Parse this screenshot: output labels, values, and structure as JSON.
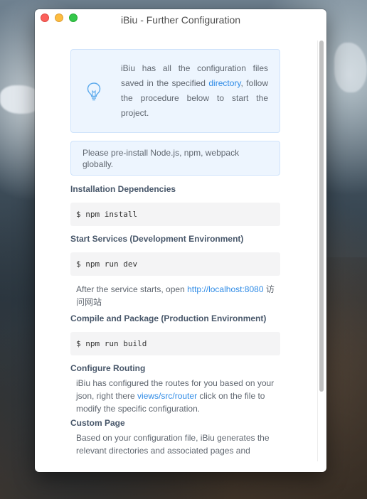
{
  "window": {
    "title": "iBiu - Further Configuration"
  },
  "info": {
    "text_before": "iBiu has all the configuration files saved in the specified ",
    "link": "directory",
    "text_after": ", follow the procedure below to start the project."
  },
  "note": {
    "text": "Please pre-install Node.js, npm, webpack globally."
  },
  "sections": {
    "install": {
      "heading": "Installation Dependencies",
      "command": "$ npm install"
    },
    "dev": {
      "heading": "Start Services (Development Environment)",
      "command": "$ npm run dev",
      "after_before": "After the service starts, open ",
      "after_link": "http://localhost:8080",
      "after_after": " 访问网站"
    },
    "build": {
      "heading": "Compile and Package (Production Environment)",
      "command": "$ npm run build"
    },
    "routing": {
      "heading": "Configure Routing",
      "text_before": "iBiu has configured the routes for you based on your json, right there ",
      "link": "views/src/router",
      "text_after": " click on the file to modify the specific configuration."
    },
    "custom": {
      "heading": "Custom Page",
      "text": "Based on your configuration file, iBiu generates the relevant directories and associated pages and"
    }
  },
  "colors": {
    "accent_link": "#2f8be6",
    "info_bg": "#edf5fe",
    "code_bg": "#f4f4f5"
  },
  "icons": {
    "info": "lightbulb-icon"
  }
}
